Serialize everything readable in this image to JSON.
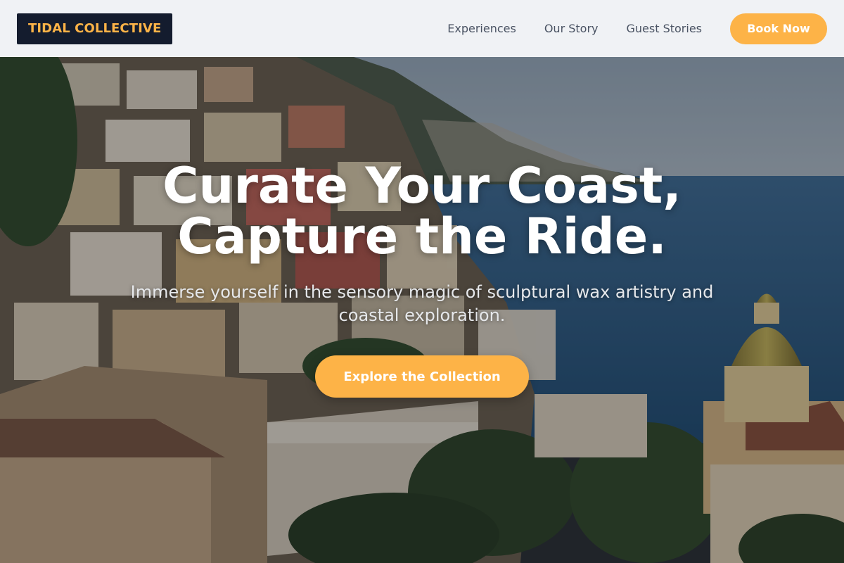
{
  "theme": {
    "accent": "#FDB347",
    "header_bg": "#F0F2F5",
    "logo_bg": "#141C2E",
    "logo_text": "#FDB347",
    "nav_text": "#4A5363",
    "button_text": "#FFFFFF",
    "hero_text": "#FFFFFF",
    "hero_subtext": "#E6E8EB"
  },
  "header": {
    "logo": "TIDAL COLLECTIVE",
    "nav": [
      {
        "label": "Experiences"
      },
      {
        "label": "Our Story"
      },
      {
        "label": "Guest Stories"
      }
    ],
    "book_button": "Book Now"
  },
  "hero": {
    "title_line1": "Curate Your Coast,",
    "title_line2": "Capture the Ride.",
    "subtitle": "Immerse yourself in the sensory magic of sculptural wax artistry and coastal exploration.",
    "cta": "Explore the Collection",
    "background_image": "Amalfi coast hillside village with pastel buildings, domed church and blue sea"
  }
}
